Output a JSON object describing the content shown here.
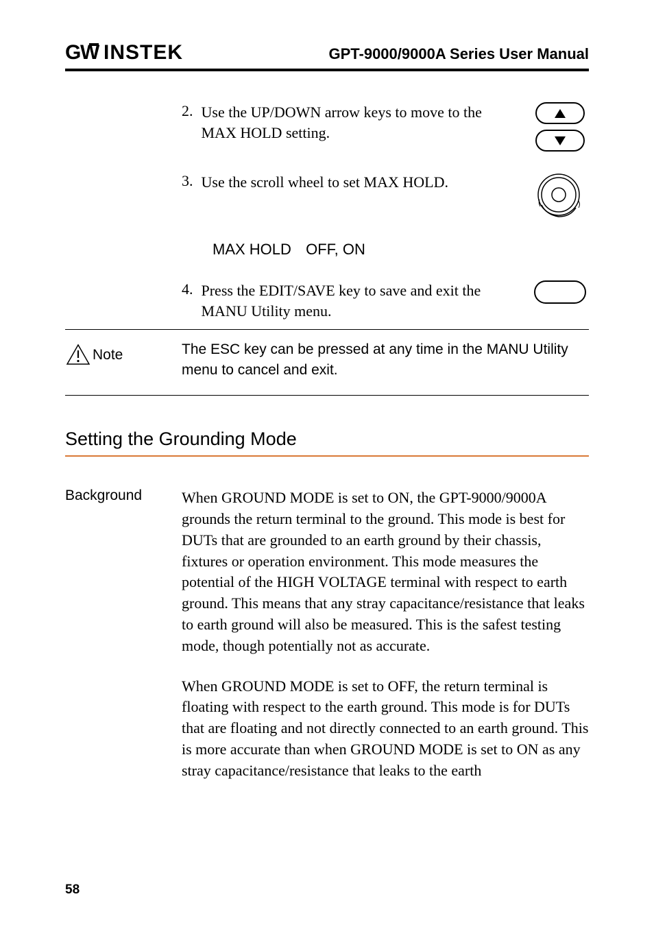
{
  "header": {
    "logo_text": "GWINSTEK",
    "title": "GPT-9000/9000A Series User Manual"
  },
  "steps": {
    "step2": {
      "num": "2.",
      "text": "Use the UP/DOWN arrow keys to move to the MAX HOLD setting."
    },
    "step3": {
      "num": "3.",
      "text": "Use the scroll wheel to set MAX HOLD."
    },
    "param": {
      "label": "MAX HOLD",
      "value": "OFF, ON"
    },
    "step4": {
      "num": "4.",
      "text": "Press the EDIT/SAVE key to save and exit the MANU Utility menu."
    }
  },
  "note": {
    "label": "Note",
    "text": "The ESC key can be pressed at any time in the MANU Utility menu to cancel and exit."
  },
  "section": {
    "heading": "Setting the Grounding Mode"
  },
  "background": {
    "label": "Background",
    "para1": "When GROUND MODE is set to ON, the GPT-9000/9000A grounds the return terminal to the ground. This mode is best for DUTs that are grounded to an earth ground by their chassis, fixtures or operation environment. This mode measures the potential of the HIGH VOLTAGE terminal with respect to earth ground. This means that any stray capacitance/resistance that leaks to earth ground will also be measured. This is the safest testing mode, though potentially not as accurate.",
    "para2": "When GROUND MODE is set to OFF, the return terminal is floating with respect to the earth ground. This mode is for DUTs that are floating and not directly connected to an earth ground. This is more accurate than when GROUND MODE is set to ON as any stray capacitance/resistance that leaks to the earth"
  },
  "page_number": "58"
}
